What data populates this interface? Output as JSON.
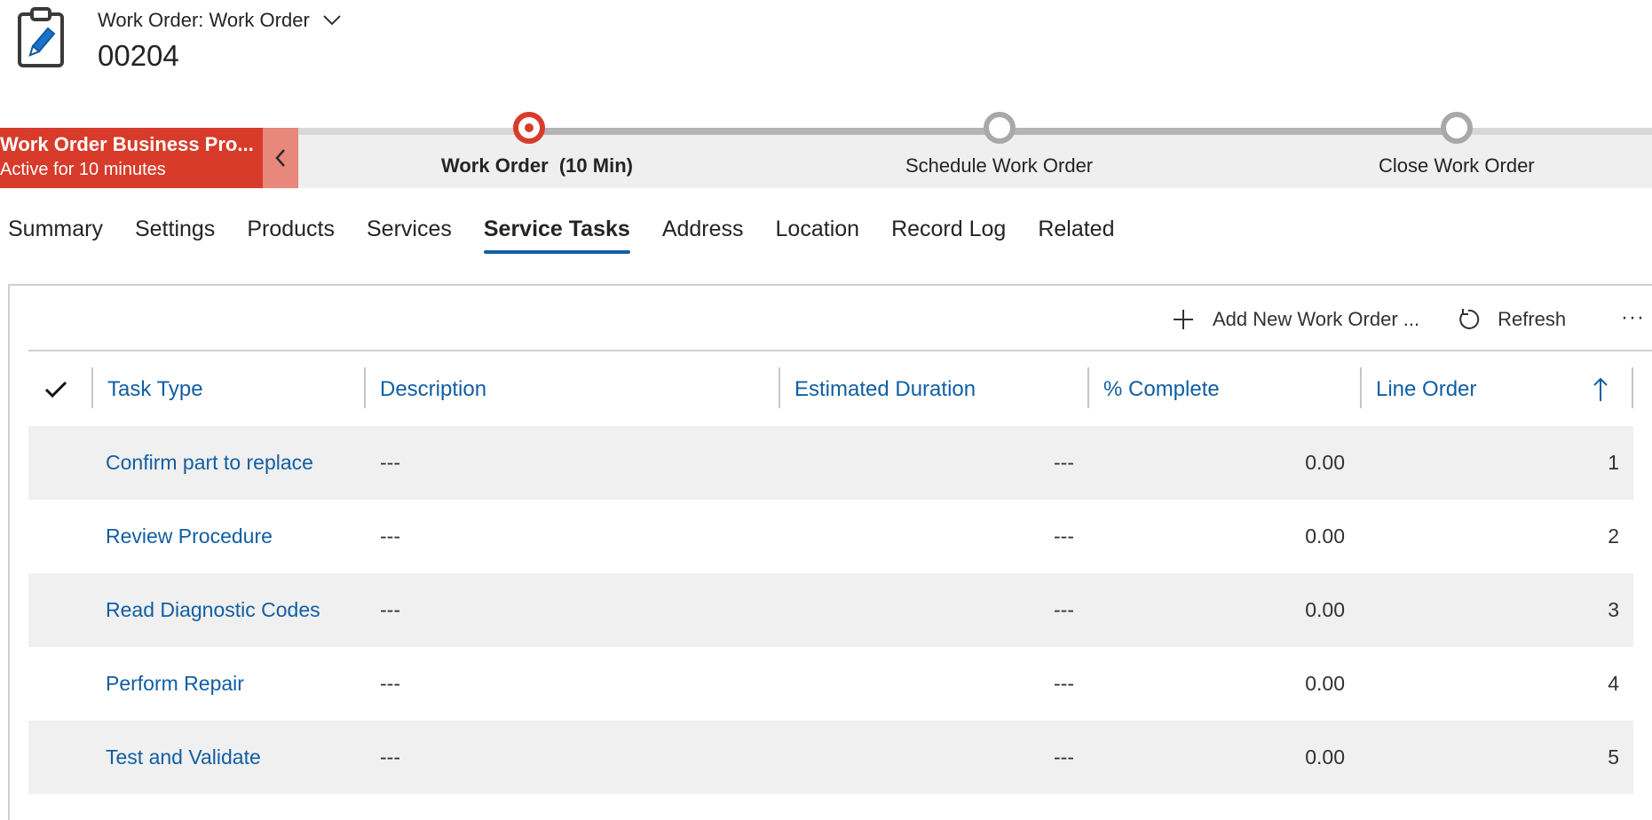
{
  "header": {
    "entity_label": "Work Order: Work Order",
    "record_number": "00204",
    "icon": "clipboard-edit-icon"
  },
  "bpf": {
    "process_name": "Work Order Business Pro...",
    "active_for": "Active for 10 minutes",
    "stages": [
      {
        "label": "Work Order  (10 Min)",
        "state": "active"
      },
      {
        "label": "Schedule Work Order",
        "state": "inactive"
      },
      {
        "label": "Close Work Order",
        "state": "inactive"
      }
    ],
    "accent_color": "#d83b2a"
  },
  "tabs": [
    {
      "label": "Summary"
    },
    {
      "label": "Settings"
    },
    {
      "label": "Products"
    },
    {
      "label": "Services"
    },
    {
      "label": "Service Tasks",
      "active": true
    },
    {
      "label": "Address"
    },
    {
      "label": "Location"
    },
    {
      "label": "Record Log"
    },
    {
      "label": "Related"
    }
  ],
  "commands": {
    "add_label": "Add New Work Order ...",
    "refresh_label": "Refresh",
    "more_label": "···"
  },
  "grid": {
    "columns": [
      "Task Type",
      "Description",
      "Estimated Duration",
      "% Complete",
      "Line Order"
    ],
    "sort": {
      "column": "Line Order",
      "direction": "ascending"
    },
    "rows": [
      {
        "task_type": "Confirm part to replace",
        "description": "---",
        "estimated_duration": "---",
        "percent_complete": "0.00",
        "line_order": "1"
      },
      {
        "task_type": "Review Procedure",
        "description": "---",
        "estimated_duration": "---",
        "percent_complete": "0.00",
        "line_order": "2"
      },
      {
        "task_type": "Read Diagnostic Codes",
        "description": "---",
        "estimated_duration": "---",
        "percent_complete": "0.00",
        "line_order": "3"
      },
      {
        "task_type": "Perform Repair",
        "description": "---",
        "estimated_duration": "---",
        "percent_complete": "0.00",
        "line_order": "4"
      },
      {
        "task_type": "Test and Validate",
        "description": "---",
        "estimated_duration": "---",
        "percent_complete": "0.00",
        "line_order": "5"
      }
    ],
    "link_color": "#115ea3"
  }
}
